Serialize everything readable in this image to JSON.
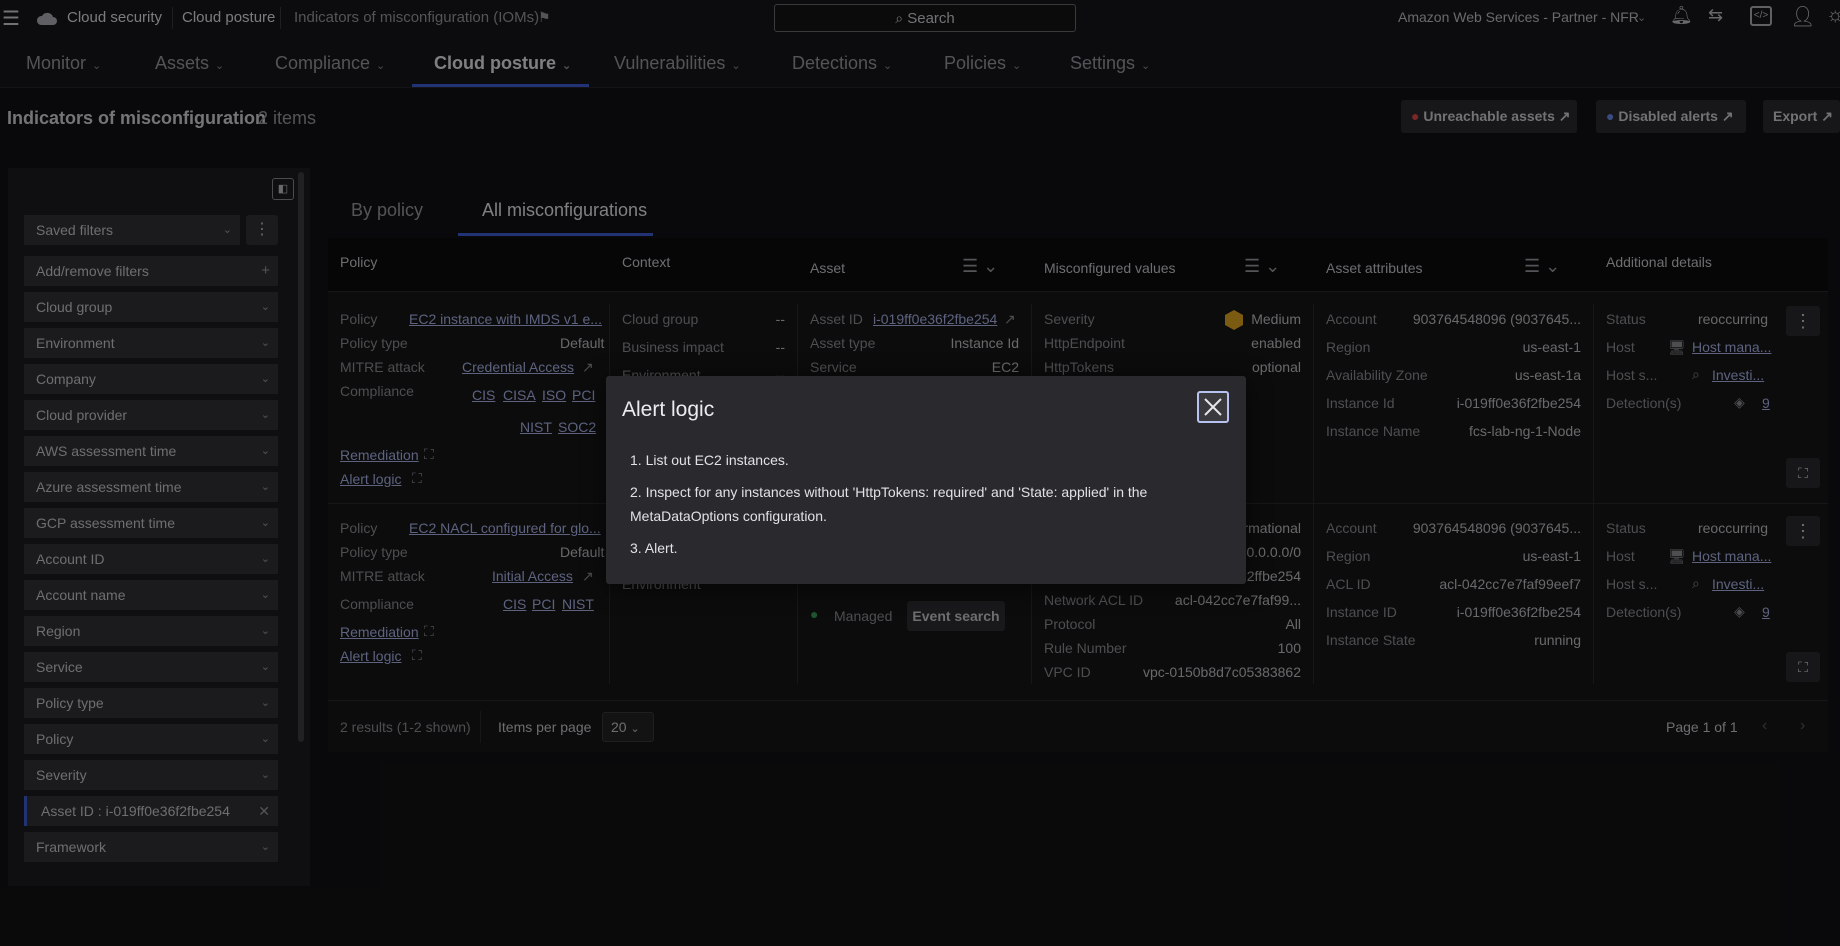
{
  "topbar": {
    "app": "Cloud security",
    "section": "Cloud posture",
    "page": "Indicators of misconfiguration (IOMs)",
    "search": "Search",
    "account": "Amazon Web Services - Partner - NFR"
  },
  "nav": [
    "Monitor",
    "Assets",
    "Compliance",
    "Cloud posture",
    "Vulnerabilities",
    "Detections",
    "Policies",
    "Settings"
  ],
  "page": {
    "title": "Indicators of misconfiguration",
    "count": "2 items",
    "buttons": {
      "unreachable": "Unreachable assets",
      "disabled": "Disabled alerts",
      "export": "Export"
    }
  },
  "filters": {
    "saved": "Saved filters",
    "add": "Add/remove filters",
    "items": [
      "Cloud group",
      "Environment",
      "Company",
      "Cloud provider",
      "AWS assessment time",
      "Azure assessment time",
      "GCP assessment time",
      "Account ID",
      "Account name",
      "Region",
      "Service",
      "Policy type",
      "Policy",
      "Severity"
    ],
    "active_label": "Asset ID :",
    "active_value": "i-019ff0e36f2fbe254",
    "after": "Framework"
  },
  "tabs": [
    "By policy",
    "All misconfigurations"
  ],
  "columns": [
    "Policy",
    "Context",
    "Asset",
    "Misconfigured values",
    "Asset attributes",
    "Additional details"
  ],
  "row1": {
    "policy": {
      "k1": "Policy",
      "v1": "EC2 instance with IMDS v1 e...",
      "k2": "Policy type",
      "v2": "Default",
      "k3": "MITRE attack",
      "v3": "Credential Access",
      "k4": "Compliance",
      "comp": [
        "CIS",
        "CISA",
        "ISO",
        "PCI",
        "NIST",
        "SOC2"
      ],
      "rem": "Remediation",
      "alert": "Alert logic"
    },
    "context": {
      "k1": "Cloud group",
      "v1": "--",
      "k2": "Business impact",
      "v2": "--",
      "k3": "Environment",
      "v3": "--"
    },
    "asset": {
      "k1": "Asset ID",
      "v1": "i-019ff0e36f2fbe254",
      "k2": "Asset type",
      "v2": "Instance Id",
      "k3": "Service",
      "v3": "EC2"
    },
    "mis": {
      "k1": "Severity",
      "v1": "Medium",
      "k2": "HttpEndpoint",
      "v2": "enabled",
      "k3": "HttpTokens",
      "v3": "optional"
    },
    "attr": {
      "k1": "Account",
      "v1": "903764548096 (9037645...",
      "k2": "Region",
      "v2": "us-east-1",
      "k3": "Availability Zone",
      "v3": "us-east-1a",
      "k4": "Instance Id",
      "v4": "i-019ff0e36f2fbe254",
      "k5": "Instance Name",
      "v5": "fcs-lab-ng-1-Node"
    },
    "add": {
      "k1": "Status",
      "v1": "reoccurring",
      "k2": "Host",
      "v2": "Host mana...",
      "k3": "Host s...",
      "v3": "Investi...",
      "k4": "Detection(s)",
      "v4": "9"
    }
  },
  "row2": {
    "policy": {
      "k1": "Policy",
      "v1": "EC2 NACL configured for glo...",
      "k2": "Policy type",
      "v2": "Default",
      "k3": "MITRE attack",
      "v3": "Initial Access",
      "k4": "Compliance",
      "comp": [
        "CIS",
        "PCI",
        "NIST"
      ],
      "rem": "Remediation",
      "alert": "Alert logic"
    },
    "context": {
      "k3": "Environment"
    },
    "asset": {
      "managed": "Managed",
      "event": "Event search"
    },
    "mis": {
      "v1": "rmational",
      "v2": "0.0.0.0/0",
      "v3": "2ffbe254",
      "k4": "Network ACL ID",
      "v4": "acl-042cc7e7faf99...",
      "k5": "Protocol",
      "v5": "All",
      "k6": "Rule Number",
      "v6": "100",
      "k7": "VPC ID",
      "v7": "vpc-0150b8d7c05383862"
    },
    "attr": {
      "k1": "Account",
      "v1": "903764548096 (9037645...",
      "k2": "Region",
      "v2": "us-east-1",
      "k3": "ACL ID",
      "v3": "acl-042cc7e7faf99eef7",
      "k4": "Instance ID",
      "v4": "i-019ff0e36f2fbe254",
      "k5": "Instance State",
      "v5": "running"
    },
    "add": {
      "k1": "Status",
      "v1": "reoccurring",
      "k2": "Host",
      "v2": "Host mana...",
      "k3": "Host s...",
      "v3": "Investi...",
      "k4": "Detection(s)",
      "v4": "9"
    }
  },
  "footer": {
    "results": "2 results (1-2 shown)",
    "ipp": "Items per page",
    "ipp_value": "20",
    "page": "Page 1 of 1"
  },
  "modal": {
    "title": "Alert logic",
    "l1": "1. List out EC2 instances.",
    "l2": "2. Inspect for any instances without 'HttpTokens: required' and 'State: applied' in the MetaDataOptions configuration.",
    "l3": "3. Alert."
  }
}
